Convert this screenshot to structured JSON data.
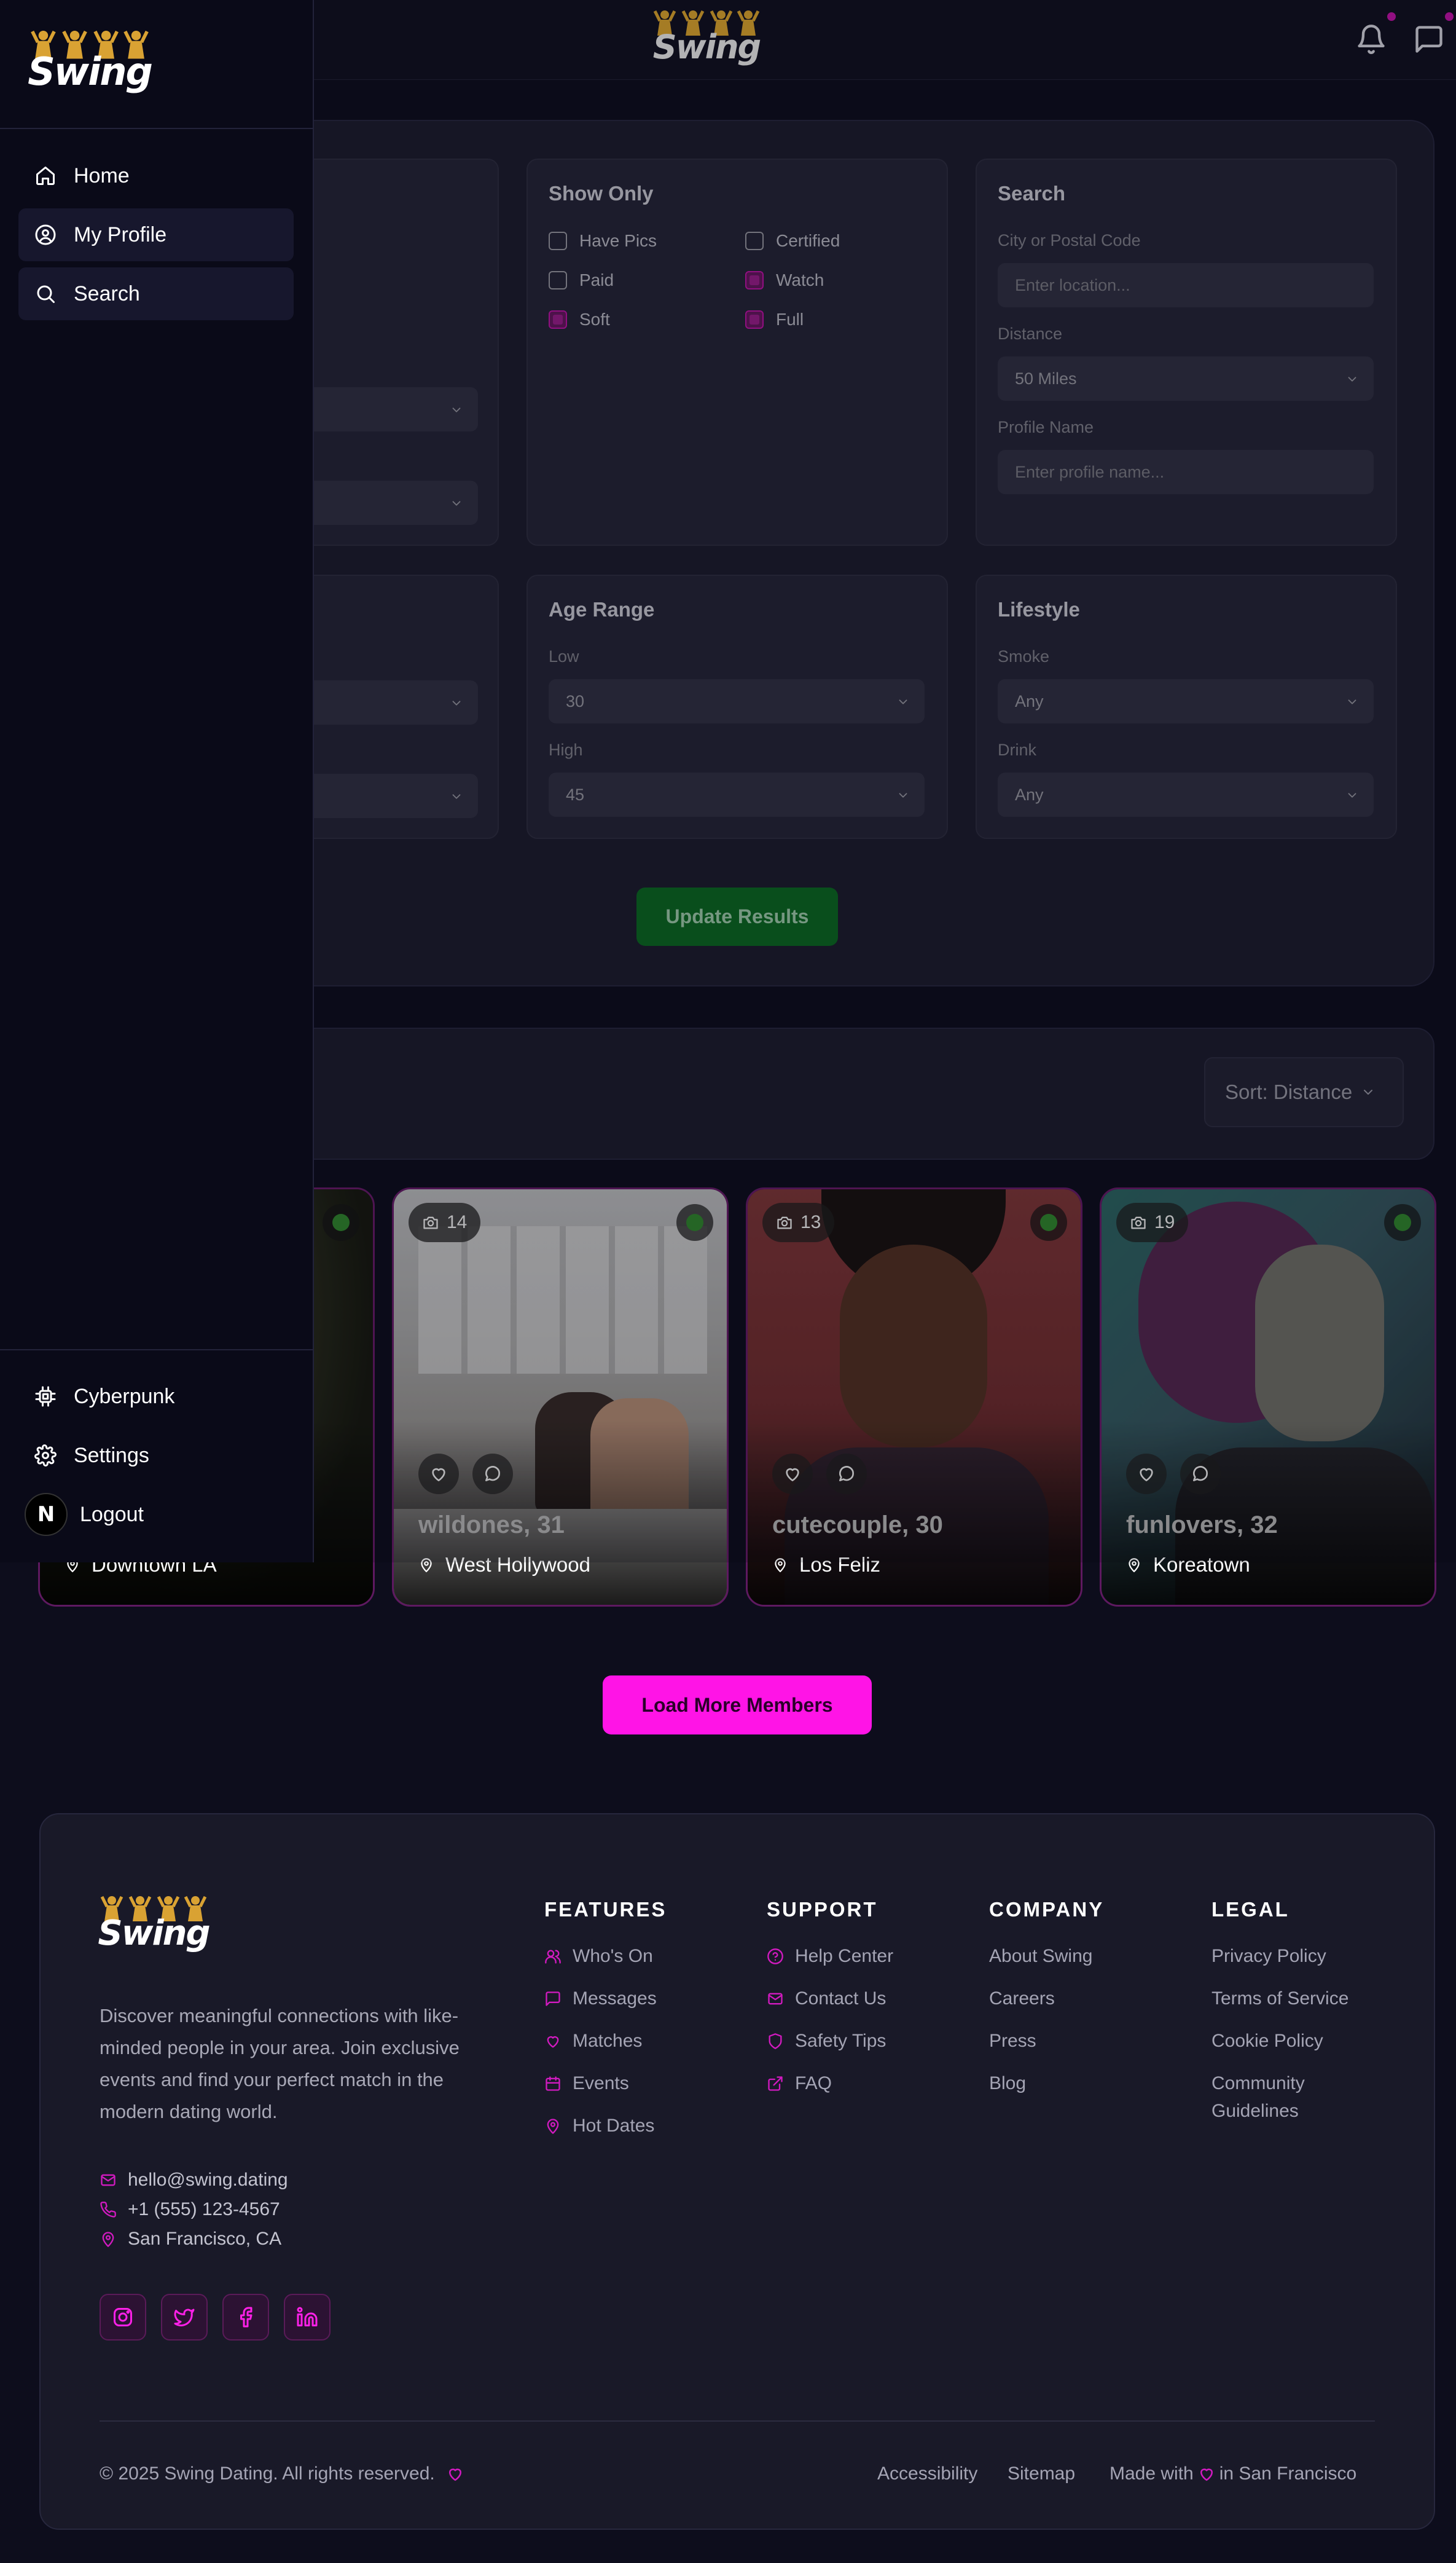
{
  "brand": {
    "logo_text": "Swing"
  },
  "header": {
    "notification_dot_color": "#b0129a"
  },
  "sidebar": {
    "items": [
      {
        "label": "Home",
        "icon": "home-icon"
      },
      {
        "label": "My Profile",
        "icon": "user-circle-icon"
      },
      {
        "label": "Search",
        "icon": "search-icon"
      }
    ],
    "bottom_items": [
      {
        "label": "Cyberpunk",
        "icon": "chip-icon"
      },
      {
        "label": "Settings",
        "icon": "gear-icon"
      },
      {
        "label": "Logout",
        "icon": "n-logo-icon"
      }
    ]
  },
  "filters": {
    "show_only": {
      "title": "Show Only",
      "options": [
        {
          "label": "Have Pics",
          "checked": false
        },
        {
          "label": "Certified",
          "checked": false
        },
        {
          "label": "Paid",
          "checked": false
        },
        {
          "label": "Watch",
          "checked": true
        },
        {
          "label": "Soft",
          "checked": true
        },
        {
          "label": "Full",
          "checked": true
        }
      ]
    },
    "search": {
      "title": "Search",
      "location_label": "City or Postal Code",
      "location_placeholder": "Enter location...",
      "distance_label": "Distance",
      "distance_value": "50 Miles",
      "name_label": "Profile Name",
      "name_placeholder": "Enter profile name..."
    },
    "age": {
      "title": "Age Range",
      "low_label": "Low",
      "low_value": "30",
      "high_label": "High",
      "high_value": "45"
    },
    "lifestyle": {
      "title": "Lifestyle",
      "smoke_label": "Smoke",
      "smoke_value": "Any",
      "drink_label": "Drink",
      "drink_value": "Any"
    },
    "update_label": "Update Results"
  },
  "sort": {
    "label": "Sort: Distance"
  },
  "members": [
    {
      "name": "",
      "location": "Downtown LA",
      "photos": ""
    },
    {
      "name": "wildones, 31",
      "location": "West Hollywood",
      "photos": "14"
    },
    {
      "name": "cutecouple, 30",
      "location": "Los Feliz",
      "photos": "13"
    },
    {
      "name": "funlovers, 32",
      "location": "Koreatown",
      "photos": "19"
    }
  ],
  "load_more_label": "Load More Members",
  "footer": {
    "description": "Discover meaningful connections with like-minded people in your area. Join exclusive events and find your perfect match in the modern dating world.",
    "email": "hello@swing.dating",
    "phone": "+1 (555) 123-4567",
    "address": "San Francisco, CA",
    "columns": [
      {
        "title": "FEATURES",
        "links": [
          "Who's On",
          "Messages",
          "Matches",
          "Events",
          "Hot Dates"
        ]
      },
      {
        "title": "SUPPORT",
        "links": [
          "Help Center",
          "Contact Us",
          "Safety Tips",
          "FAQ"
        ]
      },
      {
        "title": "COMPANY",
        "links": [
          "About Swing",
          "Careers",
          "Press",
          "Blog"
        ]
      },
      {
        "title": "LEGAL",
        "links": [
          "Privacy Policy",
          "Terms of Service",
          "Cookie Policy",
          "Community",
          "Guidelines"
        ]
      }
    ],
    "social": [
      "instagram-icon",
      "twitter-icon",
      "facebook-icon",
      "linkedin-icon"
    ],
    "copyright": "© 2025 Swing Dating. All rights reserved.",
    "bottom_links": [
      "Accessibility",
      "Sitemap"
    ],
    "made_with": "Made with",
    "made_in": "in San Francisco"
  },
  "colors": {
    "accent": "#ff14e6",
    "update_green": "#0a5f1f",
    "panel": "#1a1a2a"
  }
}
